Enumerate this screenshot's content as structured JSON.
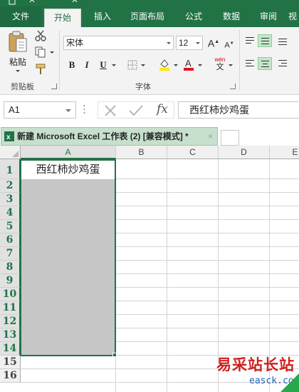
{
  "ribbon_tabs": {
    "file": "文件",
    "home": "开始",
    "insert": "插入",
    "page_layout": "页面布局",
    "formulas": "公式",
    "data": "数据",
    "review": "审阅",
    "view": "视"
  },
  "clipboard": {
    "paste": "粘贴",
    "group_label": "剪贴板"
  },
  "font": {
    "family": "宋体",
    "size": "12",
    "group_label": "字体",
    "bold": "B",
    "italic": "I",
    "underline": "U",
    "grow": "A",
    "shrink": "A",
    "phonetic_top": "wén",
    "phonetic_bottom": "文"
  },
  "formula_bar": {
    "name_box": "A1",
    "fx": "fx",
    "value": "西红柿炒鸡蛋"
  },
  "workbook_tab": {
    "title": "新建 Microsoft Excel 工作表 (2)  [兼容模式] *",
    "close": "×"
  },
  "columns": [
    "A",
    "B",
    "C",
    "D",
    "E"
  ],
  "rows": [
    "1",
    "2",
    "3",
    "4",
    "5",
    "6",
    "7",
    "8",
    "9",
    "10",
    "11",
    "12",
    "13",
    "14",
    "15",
    "16"
  ],
  "cells": {
    "A1": "西红柿炒鸡蛋"
  },
  "watermark": {
    "text": "易采站长站",
    "url": "easck.com"
  },
  "colors": {
    "accent": "#217346",
    "selection_fill": "#c6c6c6",
    "watermark_red": "#d11f1f",
    "watermark_blue": "#2563b8"
  }
}
